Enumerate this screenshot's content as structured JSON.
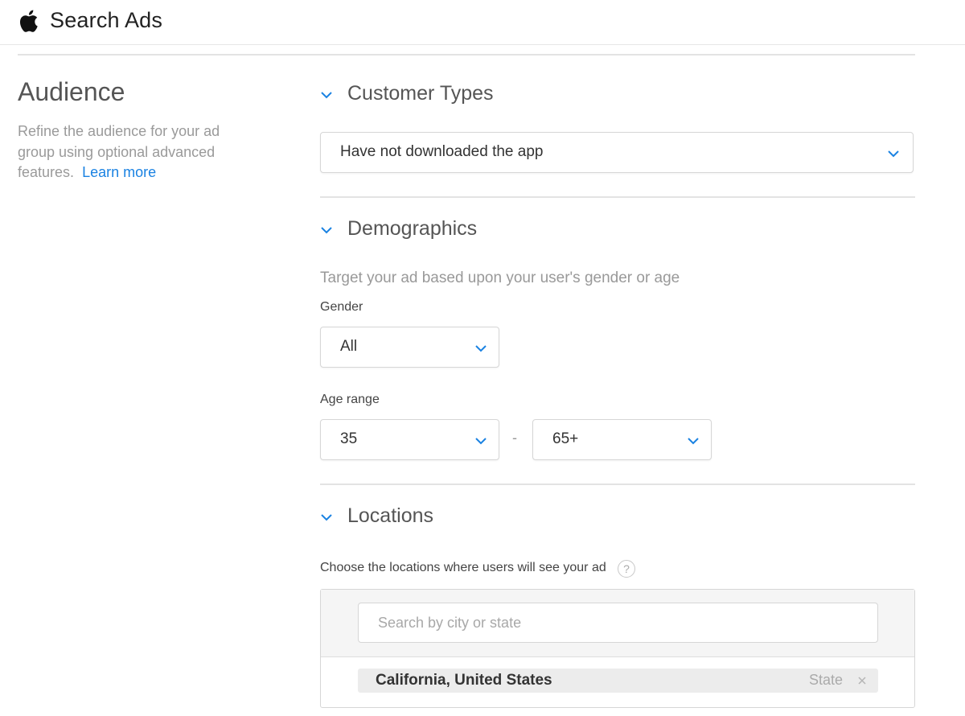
{
  "header": {
    "logo_icon": "apple-logo-icon",
    "brand": "Search Ads"
  },
  "sidebar": {
    "title": "Audience",
    "description": "Refine the audience for your ad group using optional advanced features.",
    "learn_more": "Learn more"
  },
  "customer_types": {
    "section_title": "Customer Types",
    "selected": "Have not downloaded the app"
  },
  "demographics": {
    "section_title": "Demographics",
    "helper": "Target your ad based upon your user's gender or age",
    "gender_label": "Gender",
    "gender_selected": "All",
    "age_label": "Age range",
    "age_min": "35",
    "age_separator": "-",
    "age_max": "65+"
  },
  "locations": {
    "section_title": "Locations",
    "label": "Choose the locations where users will see your ad",
    "help_icon": "?",
    "search_placeholder": "Search by city or state",
    "search_value": "",
    "items": [
      {
        "name": "California, United States",
        "type": "State"
      }
    ]
  },
  "colors": {
    "accent": "#1a82e2",
    "muted_text": "#999999",
    "border": "#d6d6d6"
  }
}
